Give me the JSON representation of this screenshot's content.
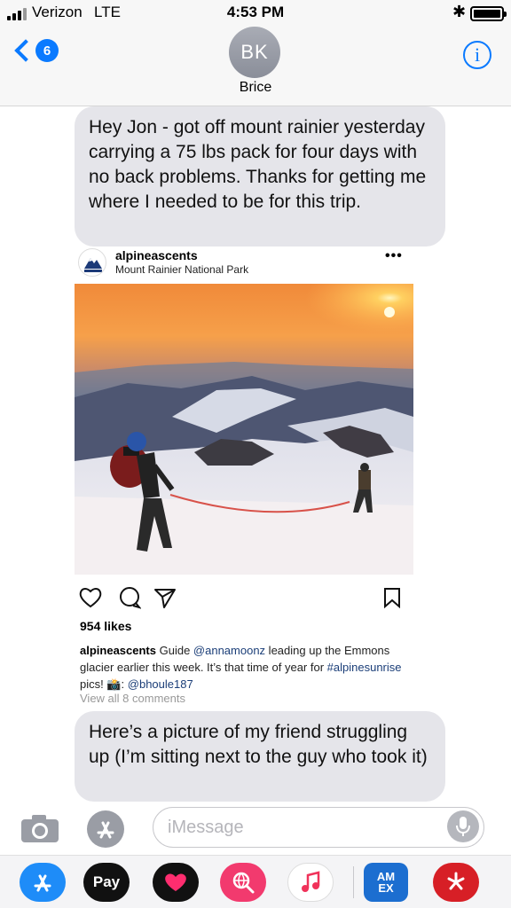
{
  "status_bar": {
    "carrier": "Verizon",
    "network": "LTE",
    "time": "4:53 PM",
    "bluetooth": "bluetooth-icon",
    "battery_level": 1.0
  },
  "header": {
    "back_count": "6",
    "avatar_initials": "BK",
    "contact_name": "Brice",
    "info_glyph": "i"
  },
  "messages": [
    {
      "text": "Hey Jon - got off mount rainier yesterday carrying a 75 lbs pack for four days with no back problems. Thanks for getting me where I needed to be for this trip."
    },
    {
      "text": "Here’s a picture of my friend struggling up (I’m sitting next to the guy who took it)"
    }
  ],
  "instagram": {
    "username": "alpineascents",
    "location": "Mount Rainier National Park",
    "more": "•••",
    "likes": "954 likes",
    "caption": {
      "user": "alpineascents",
      "parts": [
        " Guide ",
        "@annamoonz",
        " leading up the Emmons glacier earlier this week. It’s that time of year for ",
        "#alpinesunrise",
        " pics! 📸: ",
        "@bhoule187"
      ]
    },
    "view_comments": "View all 8 comments"
  },
  "input": {
    "placeholder": "iMessage"
  },
  "app_strip": {
    "apple_pay_label": "Pay",
    "amex_label": "AM EX",
    "icons": [
      "app-store-icon",
      "apple-pay-icon",
      "heart-sticker-icon",
      "web-search-icon",
      "music-icon",
      "amex-icon",
      "yelp-icon"
    ]
  },
  "colors": {
    "accent": "#0a7aff",
    "bubble": "#e5e5ea",
    "link": "#1b3e78"
  }
}
